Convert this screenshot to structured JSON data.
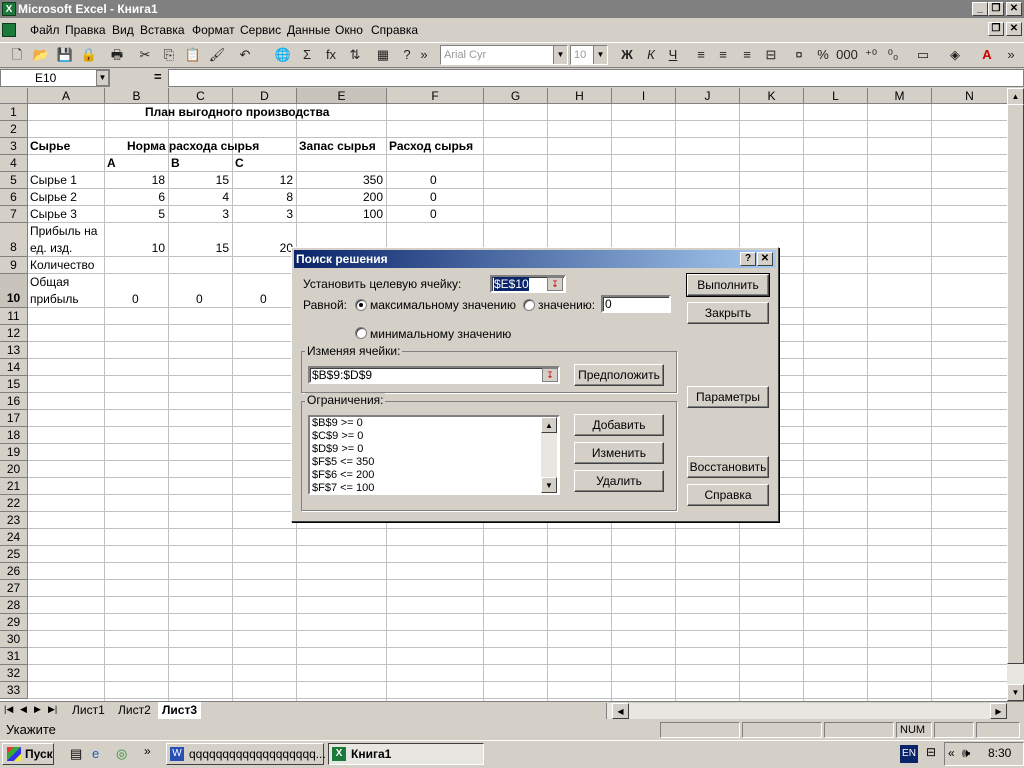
{
  "app": {
    "title": "Microsoft Excel - Книга1"
  },
  "menu": [
    "Файл",
    "Правка",
    "Вид",
    "Вставка",
    "Формат",
    "Сервис",
    "Данные",
    "Окно",
    "Справка"
  ],
  "toolbar": {
    "font": "Arial Cyr",
    "size": "10"
  },
  "formula": {
    "namebox": "E10",
    "eq": "="
  },
  "columns": [
    "A",
    "B",
    "C",
    "D",
    "E",
    "F",
    "G",
    "H",
    "I",
    "J",
    "K",
    "L",
    "M",
    "N"
  ],
  "rows": [
    "1",
    "2",
    "3",
    "4",
    "5",
    "6",
    "7",
    "8",
    "9",
    "10",
    "11",
    "12",
    "13",
    "14",
    "15",
    "16",
    "17",
    "18",
    "19",
    "20",
    "21",
    "22",
    "23",
    "24",
    "25",
    "26",
    "27",
    "28",
    "29",
    "30",
    "31",
    "32",
    "33"
  ],
  "sheet": {
    "title": "План выгодного производства",
    "a3": "Сырье",
    "b3": "Норма расхода сырья",
    "e3": "Запас сырья",
    "f3": "Расход сырья",
    "b4": "A",
    "c4": "B",
    "d4": "C",
    "a5": "Сырье 1",
    "b5": "18",
    "c5": "15",
    "d5": "12",
    "e5": "350",
    "f5": "0",
    "a6": "Сырье 2",
    "b6": "6",
    "c6": "4",
    "d6": "8",
    "e6": "200",
    "f6": "0",
    "a7": "Сырье 3",
    "b7": "5",
    "c7": "3",
    "d7": "3",
    "e7": "100",
    "f7": "0",
    "a8a": "Прибыль на",
    "a8b": "ед. изд.",
    "b8": "10",
    "c8": "15",
    "d8": "20",
    "a9": "Количество",
    "a10a": "Общая",
    "a10b": "прибыль",
    "b10": "0",
    "c10": "0",
    "d10": "0"
  },
  "tabs": [
    "Лист1",
    "Лист2",
    "Лист3"
  ],
  "status": {
    "text": "Укажите",
    "num": "NUM"
  },
  "taskbar": {
    "start": "Пуск",
    "task1": "qqqqqqqqqqqqqqqqqqq...",
    "task2": "Книга1",
    "lang": "EN",
    "time": "8:30"
  },
  "dialog": {
    "title": "Поиск решения",
    "target_label": "Установить целевую ячейку:",
    "target_value": "$E$10",
    "equal_label": "Равной:",
    "opt_max": "максимальному значению",
    "opt_value": "значению:",
    "value_field": "0",
    "opt_min": "минимальному значению",
    "changing_label": "Изменяя ячейки:",
    "changing_value": "$B$9:$D$9",
    "guess": "Предположить",
    "constraints_label": "Ограничения:",
    "constraints": [
      "$B$9 >= 0",
      "$C$9 >= 0",
      "$D$9 >= 0",
      "$F$5 <= 350",
      "$F$6 <= 200",
      "$F$7 <= 100"
    ],
    "add": "Добавить",
    "change": "Изменить",
    "delete": "Удалить",
    "solve": "Выполнить",
    "close": "Закрыть",
    "options": "Параметры",
    "reset": "Восстановить",
    "help": "Справка"
  }
}
